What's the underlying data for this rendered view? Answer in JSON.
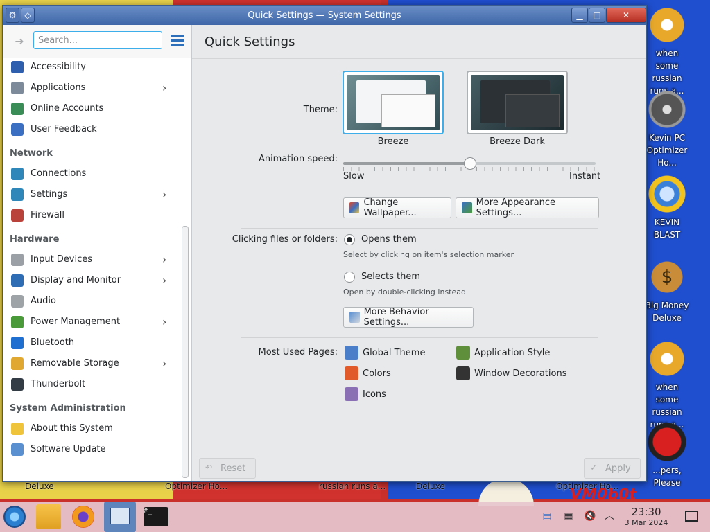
{
  "desktop": {
    "icons": [
      {
        "name": "gear-icon",
        "label": "when some russian runs a..."
      },
      {
        "name": "gauge-icon",
        "label": "Kevin PC Optimizer Ho..."
      },
      {
        "name": "blast-icon",
        "label": "KEVIN BLAST"
      },
      {
        "name": "money-bag-icon",
        "label": "Big Money Deluxe"
      },
      {
        "name": "gear-icon",
        "label": "when some russian runs a..."
      },
      {
        "name": "red-sphere-icon",
        "label": "...pers, Please"
      }
    ],
    "strip_labels": [
      "Deluxe",
      "Optimizer Ho...",
      "russian runs a...",
      "Deluxe",
      "Optimizer Ho..."
    ],
    "watermark": "VM0b0t",
    "money_glyph": "$"
  },
  "window": {
    "title": "Quick Settings — System Settings",
    "buttons": {
      "minimize": "▁",
      "maximize": "□",
      "close": "✕",
      "pin": "◇"
    }
  },
  "sidebar": {
    "search_placeholder": "Search...",
    "items": [
      {
        "type": "item",
        "label": "Accessibility",
        "icon": "accessibility-icon",
        "color": "#2e5fae",
        "chevron": false
      },
      {
        "type": "item",
        "label": "Applications",
        "icon": "applications-icon",
        "color": "#7d8a99",
        "chevron": true
      },
      {
        "type": "item",
        "label": "Online Accounts",
        "icon": "online-accounts-icon",
        "color": "#3b8d57",
        "chevron": false
      },
      {
        "type": "item",
        "label": "User Feedback",
        "icon": "user-feedback-icon",
        "color": "#3a6fc2",
        "chevron": false
      },
      {
        "type": "header",
        "label": "Network"
      },
      {
        "type": "item",
        "label": "Connections",
        "icon": "connections-icon",
        "color": "#2f86b8",
        "chevron": false
      },
      {
        "type": "item",
        "label": "Settings",
        "icon": "network-settings-icon",
        "color": "#2f86b8",
        "chevron": true
      },
      {
        "type": "item",
        "label": "Firewall",
        "icon": "firewall-icon",
        "color": "#b9423a",
        "chevron": false
      },
      {
        "type": "header",
        "label": "Hardware"
      },
      {
        "type": "item",
        "label": "Input Devices",
        "icon": "input-devices-icon",
        "color": "#9aa0a6",
        "chevron": true
      },
      {
        "type": "item",
        "label": "Display and Monitor",
        "icon": "display-icon",
        "color": "#2e6db4",
        "chevron": true
      },
      {
        "type": "item",
        "label": "Audio",
        "icon": "audio-icon",
        "color": "#9ea3a8",
        "chevron": false
      },
      {
        "type": "item",
        "label": "Power Management",
        "icon": "power-icon",
        "color": "#4a9a3a",
        "chevron": true
      },
      {
        "type": "item",
        "label": "Bluetooth",
        "icon": "bluetooth-icon",
        "color": "#1e6fd0",
        "chevron": false
      },
      {
        "type": "item",
        "label": "Removable Storage",
        "icon": "removable-storage-icon",
        "color": "#e0a830",
        "chevron": true
      },
      {
        "type": "item",
        "label": "Thunderbolt",
        "icon": "thunderbolt-icon",
        "color": "#333b44",
        "chevron": false
      },
      {
        "type": "header",
        "label": "System Administration"
      },
      {
        "type": "item",
        "label": "About this System",
        "icon": "about-icon",
        "color": "#f0c43a",
        "chevron": false
      },
      {
        "type": "item",
        "label": "Software Update",
        "icon": "software-update-icon",
        "color": "#5a8fd0",
        "chevron": false
      }
    ]
  },
  "main": {
    "title": "Quick Settings",
    "theme_label": "Theme:",
    "themes": [
      {
        "name": "Breeze",
        "selected": true
      },
      {
        "name": "Breeze Dark",
        "selected": false
      }
    ],
    "animation_label": "Animation speed:",
    "animation": {
      "min_label": "Slow",
      "max_label": "Instant",
      "value_percent": 50
    },
    "change_wallpaper": "Change Wallpaper...",
    "more_appearance": "More Appearance Settings...",
    "clicking_label": "Clicking files or folders:",
    "opens_them": "Opens them",
    "opens_hint": "Select by clicking on item's selection marker",
    "selects_them": "Selects them",
    "selects_hint": "Open by double-clicking instead",
    "more_behavior": "More Behavior Settings...",
    "most_used_label": "Most Used Pages:",
    "most_used": [
      {
        "label": "Global Theme",
        "icon": "global-theme-icon",
        "color": "#4a7ec9"
      },
      {
        "label": "Application Style",
        "icon": "application-style-icon",
        "color": "#5f8f3a"
      },
      {
        "label": "Colors",
        "icon": "colors-icon",
        "color": "#e05a2a"
      },
      {
        "label": "Window Decorations",
        "icon": "window-decorations-icon",
        "color": "#333333"
      },
      {
        "label": "Icons",
        "icon": "icons-icon",
        "color": "#8a6fb5"
      }
    ],
    "reset": "Reset",
    "apply": "Apply"
  },
  "taskbar": {
    "time": "23:30",
    "date": "3 Mar 2024",
    "terminal_glyph": "#_",
    "tray_glyphs": {
      "clipboard": "▤",
      "sound": "🔇",
      "expand": "︿"
    }
  }
}
